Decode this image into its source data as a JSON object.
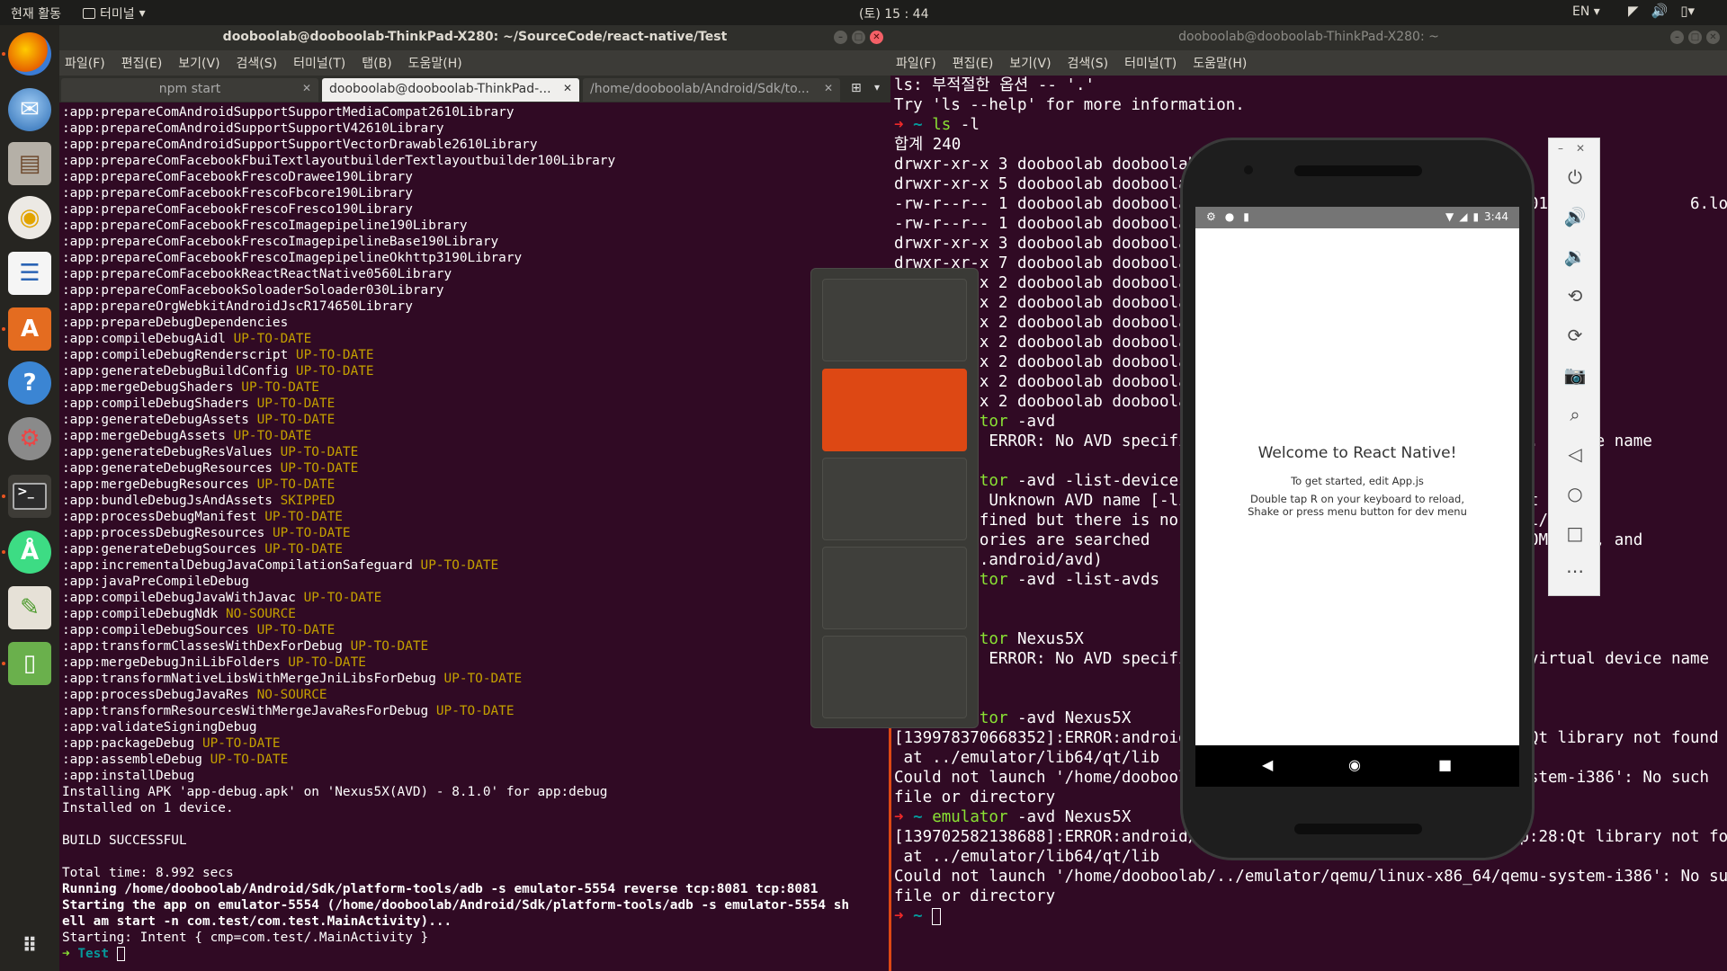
{
  "topbar": {
    "activities": "현재 활동",
    "app_menu": "터미널",
    "clock": "(토) 15 : 44",
    "lang": "EN",
    "tray_icons": [
      "wifi-icon",
      "volume-icon",
      "battery-icon"
    ]
  },
  "dock": {
    "items": [
      "firefox",
      "thunderbird",
      "files",
      "rhythmbox",
      "libreoffice-writer",
      "ubuntu-software",
      "help",
      "settings",
      "terminal",
      "android-studio",
      "image-viewer",
      "android-emulator"
    ],
    "grid_label": "apps-grid-icon"
  },
  "left_window": {
    "title": "dooboolab@dooboolab-ThinkPad-X280: ~/SourceCode/react-native/Test",
    "menu": [
      "파일(F)",
      "편집(E)",
      "보기(V)",
      "검색(S)",
      "터미널(T)",
      "탭(B)",
      "도움말(H)"
    ],
    "tabs": [
      {
        "label": "npm start",
        "active": false
      },
      {
        "label": "dooboolab@dooboolab-ThinkPad-...",
        "active": true
      },
      {
        "label": "/home/dooboolab/Android/Sdk/to...",
        "active": false
      }
    ],
    "lines": [
      {
        "t": ":app:prepareComAndroidSupportSupportMediaCompat2610Library",
        "s": ""
      },
      {
        "t": ":app:prepareComAndroidSupportSupportV42610Library",
        "s": ""
      },
      {
        "t": ":app:prepareComAndroidSupportSupportVectorDrawable2610Library",
        "s": ""
      },
      {
        "t": ":app:prepareComFacebookFbuiTextlayoutbuilderTextlayoutbuilder100Library",
        "s": ""
      },
      {
        "t": ":app:prepareComFacebookFrescoDrawee190Library",
        "s": ""
      },
      {
        "t": ":app:prepareComFacebookFrescoFbcore190Library",
        "s": ""
      },
      {
        "t": ":app:prepareComFacebookFrescoFresco190Library",
        "s": ""
      },
      {
        "t": ":app:prepareComFacebookFrescoImagepipeline190Library",
        "s": ""
      },
      {
        "t": ":app:prepareComFacebookFrescoImagepipelineBase190Library",
        "s": ""
      },
      {
        "t": ":app:prepareComFacebookFrescoImagepipelineOkhttp3190Library",
        "s": ""
      },
      {
        "t": ":app:prepareComFacebookReactReactNative0560Library",
        "s": ""
      },
      {
        "t": ":app:prepareComFacebookSoloaderSoloader030Library",
        "s": ""
      },
      {
        "t": ":app:prepareOrgWebkitAndroidJscR174650Library",
        "s": ""
      },
      {
        "t": ":app:prepareDebugDependencies",
        "s": ""
      },
      {
        "t": ":app:compileDebugAidl ",
        "s": "UP-TO-DATE"
      },
      {
        "t": ":app:compileDebugRenderscript ",
        "s": "UP-TO-DATE"
      },
      {
        "t": ":app:generateDebugBuildConfig ",
        "s": "UP-TO-DATE"
      },
      {
        "t": ":app:mergeDebugShaders ",
        "s": "UP-TO-DATE"
      },
      {
        "t": ":app:compileDebugShaders ",
        "s": "UP-TO-DATE"
      },
      {
        "t": ":app:generateDebugAssets ",
        "s": "UP-TO-DATE"
      },
      {
        "t": ":app:mergeDebugAssets ",
        "s": "UP-TO-DATE"
      },
      {
        "t": ":app:generateDebugResValues ",
        "s": "UP-TO-DATE"
      },
      {
        "t": ":app:generateDebugResources ",
        "s": "UP-TO-DATE"
      },
      {
        "t": ":app:mergeDebugResources ",
        "s": "UP-TO-DATE"
      },
      {
        "t": ":app:bundleDebugJsAndAssets ",
        "s": "SKIPPED"
      },
      {
        "t": ":app:processDebugManifest ",
        "s": "UP-TO-DATE"
      },
      {
        "t": ":app:processDebugResources ",
        "s": "UP-TO-DATE"
      },
      {
        "t": ":app:generateDebugSources ",
        "s": "UP-TO-DATE"
      },
      {
        "t": ":app:incrementalDebugJavaCompilationSafeguard ",
        "s": "UP-TO-DATE"
      },
      {
        "t": ":app:javaPreCompileDebug",
        "s": ""
      },
      {
        "t": ":app:compileDebugJavaWithJavac ",
        "s": "UP-TO-DATE"
      },
      {
        "t": ":app:compileDebugNdk ",
        "s": "NO-SOURCE"
      },
      {
        "t": ":app:compileDebugSources ",
        "s": "UP-TO-DATE"
      },
      {
        "t": ":app:transformClassesWithDexForDebug ",
        "s": "UP-TO-DATE"
      },
      {
        "t": ":app:mergeDebugJniLibFolders ",
        "s": "UP-TO-DATE"
      },
      {
        "t": ":app:transformNativeLibsWithMergeJniLibsForDebug ",
        "s": "UP-TO-DATE"
      },
      {
        "t": ":app:processDebugJavaRes ",
        "s": "NO-SOURCE"
      },
      {
        "t": ":app:transformResourcesWithMergeJavaResForDebug ",
        "s": "UP-TO-DATE"
      },
      {
        "t": ":app:validateSigningDebug",
        "s": ""
      },
      {
        "t": ":app:packageDebug ",
        "s": "UP-TO-DATE"
      },
      {
        "t": ":app:assembleDebug ",
        "s": "UP-TO-DATE"
      },
      {
        "t": ":app:installDebug",
        "s": ""
      },
      {
        "t": "Installing APK 'app-debug.apk' on 'Nexus5X(AVD) - 8.1.0' for app:debug",
        "s": ""
      },
      {
        "t": "Installed on 1 device.",
        "s": ""
      },
      {
        "t": "",
        "s": ""
      },
      {
        "t": "BUILD SUCCESSFUL",
        "s": ""
      },
      {
        "t": "",
        "s": ""
      },
      {
        "t": "Total time: 8.992 secs",
        "s": ""
      },
      {
        "t": "Running /home/dooboolab/Android/Sdk/platform-tools/adb -s emulator-5554 reverse tcp:8081 tcp:8081",
        "s": "",
        "bold": true
      },
      {
        "t": "Starting the app on emulator-5554 (/home/dooboolab/Android/Sdk/platform-tools/adb -s emulator-5554 sh",
        "s": "",
        "bold": true
      },
      {
        "t": "ell am start -n com.test/com.test.MainActivity)...",
        "s": "",
        "bold": true
      },
      {
        "t": "Starting: Intent { cmp=com.test/.MainActivity }",
        "s": ""
      }
    ],
    "prompt_arrow": "➜",
    "prompt_dir": "Test"
  },
  "workspaces": {
    "count": 5,
    "active_index": 1
  },
  "right_window": {
    "title": "dooboolab@dooboolab-ThinkPad-X280: ~",
    "menu": [
      "파일(F)",
      "편집(E)",
      "보기(V)",
      "검색(S)",
      "터미널(T)",
      "도움말(H)"
    ],
    "lines": [
      {
        "p": "",
        "t": "ls: 부적절한 옵션 -- '.'"
      },
      {
        "p": "",
        "t": "Try 'ls --help' for more information."
      },
      {
        "p": "ls",
        "t": " -l"
      },
      {
        "p": "",
        "t": "합계 240"
      },
      {
        "p": "",
        "t": "drwxr-xr-x 3 dooboolab dooboolab"
      },
      {
        "p": "",
        "t": "drwxr-xr-x 5 dooboolab dooboolab"
      },
      {
        "p": "",
        "t": "-rw-r--r-- 1 dooboolab dooboolab                                   01               6.log"
      },
      {
        "p": "",
        "t": "-rw-r--r-- 1 dooboolab dooboolab"
      },
      {
        "p": "",
        "t": "drwxr-xr-x 3 dooboolab dooboolab"
      },
      {
        "p": "",
        "t": "drwxr-xr-x 7 dooboolab dooboolab"
      },
      {
        "p": "",
        "t": "drwxr-xr-x 2 dooboolab dooboolab"
      },
      {
        "p": "",
        "t": "drwxr-xr-x 2 dooboolab dooboolab"
      },
      {
        "p": "",
        "t": "drwxr-xr-x 2 dooboolab dooboolab"
      },
      {
        "p": "",
        "t": "drwxr-xr-x 2 dooboolab dooboolab"
      },
      {
        "p": "",
        "t": "drwxr-xr-x 2 dooboolab dooboolab"
      },
      {
        "p": "",
        "t": "drwxr-xr-x 2 dooboolab dooboolab"
      },
      {
        "p": "",
        "t": "drwxr-xr-x 2 dooboolab dooboolab"
      },
      {
        "p": "emulator",
        "t": " -avd"
      },
      {
        "p": "",
        "t": "emulator: ERROR: No AVD specifie                                   . device name"
      },
      {
        "p": "",
        "t": ""
      },
      {
        "p": "emulator",
        "t": " -avd -list-devices"
      },
      {
        "p": "",
        "t": "emulator: Unknown AVD name [-list-c                               st"
      },
      {
        "p": "",
        "t": "   not defined but there is no                                     l/"
      },
      {
        "p": "",
        "t": "   directories are searched                                        OME/avd, and"
      },
      {
        "p": "",
        "t": "   $HOME/.android/avd)"
      },
      {
        "p": "emulator",
        "t": " -avd -list-avds"
      },
      {
        "p": "",
        "t": ""
      },
      {
        "p": "",
        "t": ""
      },
      {
        "p": "emulator",
        "t": " Nexus5X"
      },
      {
        "p": "",
        "t": "emulator: ERROR: No AVD specifie                                   virtual device name"
      },
      {
        "p": "",
        "t": ""
      },
      {
        "p": "",
        "t": ""
      },
      {
        "p": "emulator",
        "t": " -avd Nexus5X"
      },
      {
        "p": "",
        "t": "[139978370668352]:ERROR:android/                                   Qt library not found"
      },
      {
        "p": "",
        "t": " at ../emulator/lib64/qt/lib"
      },
      {
        "p": "",
        "t": "Could not launch '/home/dooboola                                   stem-i386': No such"
      },
      {
        "p": "",
        "t": "file or directory"
      },
      {
        "p": "emulator",
        "t": " -avd Nexus5X"
      },
      {
        "p": "",
        "t": "[139702582138688]:ERROR:android/android-emu/android/qt/qt_setup.cpp:28:Qt library not found"
      },
      {
        "p": "",
        "t": " at ../emulator/lib64/qt/lib"
      },
      {
        "p": "",
        "t": "Could not launch '/home/dooboolab/../emulator/qemu/linux-x86_64/qemu-system-i386': No such"
      },
      {
        "p": "",
        "t": "file or directory"
      },
      {
        "p": "prompt",
        "t": ""
      }
    ],
    "prompt_arrow": "➜",
    "prompt_tilde": "~"
  },
  "emulator": {
    "status_time": "3:44",
    "welcome": "Welcome to React Native!",
    "instructions1": "To get started, edit App.js",
    "instructions2": "Double tap R on your keyboard to reload,",
    "instructions3": "Shake or press menu button for dev menu",
    "toolbar": [
      "power-icon",
      "volume-up-icon",
      "volume-down-icon",
      "rotate-left-icon",
      "rotate-right-icon",
      "camera-icon",
      "zoom-icon",
      "back-icon",
      "home-icon",
      "overview-icon",
      "more-icon"
    ]
  },
  "colors": {
    "terminal_bg": "#300a24",
    "accent": "#dd4814",
    "status_yellow": "#c4a000",
    "prompt_red": "#ef2929",
    "cyan": "#06989a"
  }
}
